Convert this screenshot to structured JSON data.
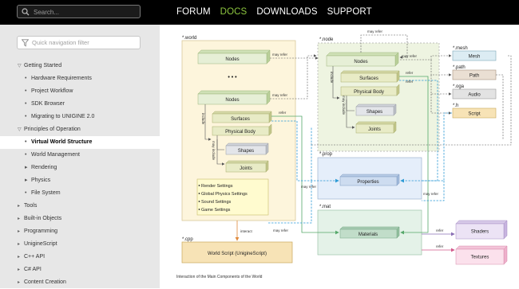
{
  "search": {
    "placeholder": "Search..."
  },
  "nav": [
    {
      "label": "FORUM"
    },
    {
      "label": "DOCS"
    },
    {
      "label": "DOWNLOADS"
    },
    {
      "label": "SUPPORT"
    }
  ],
  "filter": {
    "placeholder": "Quick navigation filter"
  },
  "sidebar": {
    "items": [
      {
        "label": "Getting Started",
        "level": 0,
        "marker": "▽"
      },
      {
        "label": "Hardware Requirements",
        "level": 1,
        "marker": "•"
      },
      {
        "label": "Project Workflow",
        "level": 1,
        "marker": "•"
      },
      {
        "label": "SDK Browser",
        "level": 1,
        "marker": "•"
      },
      {
        "label": "Migrating to UNIGINE 2.0",
        "level": 1,
        "marker": "•"
      },
      {
        "label": "Principles of Operation",
        "level": 0,
        "marker": "▽"
      },
      {
        "label": "Virtual World Structure",
        "level": 1,
        "marker": "•",
        "active": true
      },
      {
        "label": "World Management",
        "level": 1,
        "marker": "•"
      },
      {
        "label": "Rendering",
        "level": 1,
        "marker": "▸"
      },
      {
        "label": "Physics",
        "level": 1,
        "marker": "▸"
      },
      {
        "label": "File System",
        "level": 1,
        "marker": "•"
      },
      {
        "label": "Tools",
        "level": 0,
        "marker": "▸"
      },
      {
        "label": "Built-in Objects",
        "level": 0,
        "marker": "▸"
      },
      {
        "label": "Programming",
        "level": 0,
        "marker": "▸"
      },
      {
        "label": "UnigineScript",
        "level": 0,
        "marker": "▸"
      },
      {
        "label": "C++ API",
        "level": 0,
        "marker": "▸"
      },
      {
        "label": "C# API",
        "level": 0,
        "marker": "▸"
      },
      {
        "label": "Content Creation",
        "level": 0,
        "marker": "▸"
      }
    ]
  },
  "diagram": {
    "world_label": "*.world",
    "node_label": "*.node",
    "mesh_label": "*.mesh",
    "path_label": "*.path",
    "oga_label": "*.oga",
    "h_label": "*.h",
    "prop_label": "*.prop",
    "mat_label": "*.mat",
    "cpp_label": "*.cpp",
    "nodes": "Nodes",
    "ellipsis": "• • •",
    "surfaces": "Surfaces",
    "physical_body": "Physical  Body",
    "shapes": "Shapes",
    "joints": "Joints",
    "mesh": "Mesh",
    "path": "Path",
    "audio": "Audio",
    "script": "Script",
    "properties": "Properties",
    "materials": "Materials",
    "shaders": "Shaders",
    "textures": "Textures",
    "world_script": "World Script (UnigineScript)",
    "settings": [
      "Render Settings",
      "Global Physics Settings",
      "Sound Settings",
      "Game Settings"
    ],
    "may_refer": "may refer",
    "refer": "refer",
    "may_include": "may include",
    "include": "include",
    "interact": "interact",
    "caption": "Interaction of the Main Components of the World"
  },
  "colors": {
    "accent": "#8dc63f",
    "world_bg": "#fdf5dc",
    "node_bg": "#eef4e1",
    "prop_bg": "#e5eefa",
    "mat_bg": "#e4f2e8",
    "shaders_bg": "#ece3f5",
    "textures_bg": "#fbe1ec",
    "cpp_bg": "#f7e3b6"
  }
}
